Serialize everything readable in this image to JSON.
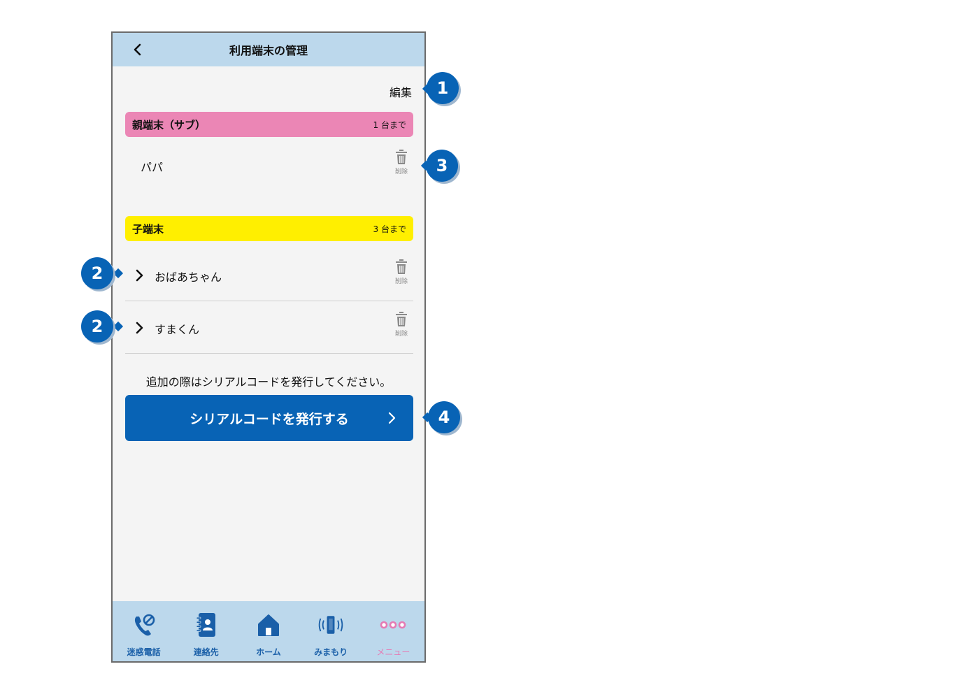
{
  "header": {
    "title": "利用端末の管理"
  },
  "edit_label": "編集",
  "parent_section": {
    "title": "親端末（サブ）",
    "limit": "1 台まで"
  },
  "parent_device": {
    "name": "パパ",
    "delete_label": "削除"
  },
  "child_section": {
    "title": "子端末",
    "limit": "3 台まで"
  },
  "child_devices": [
    {
      "name": "おばあちゃん",
      "delete_label": "削除"
    },
    {
      "name": "すまくん",
      "delete_label": "削除"
    }
  ],
  "note": "追加の際はシリアルコードを発行してください。",
  "serial_button": {
    "label": "シリアルコードを発行する"
  },
  "nav": [
    {
      "label": "迷惑電話"
    },
    {
      "label": "連絡先"
    },
    {
      "label": "ホーム"
    },
    {
      "label": "みまもり"
    },
    {
      "label": "メニュー"
    }
  ],
  "callouts": [
    "1",
    "2",
    "2",
    "3",
    "4"
  ],
  "colors": {
    "header_bg": "#bcd8ec",
    "parent_bar": "#eb86b5",
    "child_bar": "#ffef00",
    "accent_blue": "#0863b5",
    "menu_pink": "#e57bb4"
  }
}
